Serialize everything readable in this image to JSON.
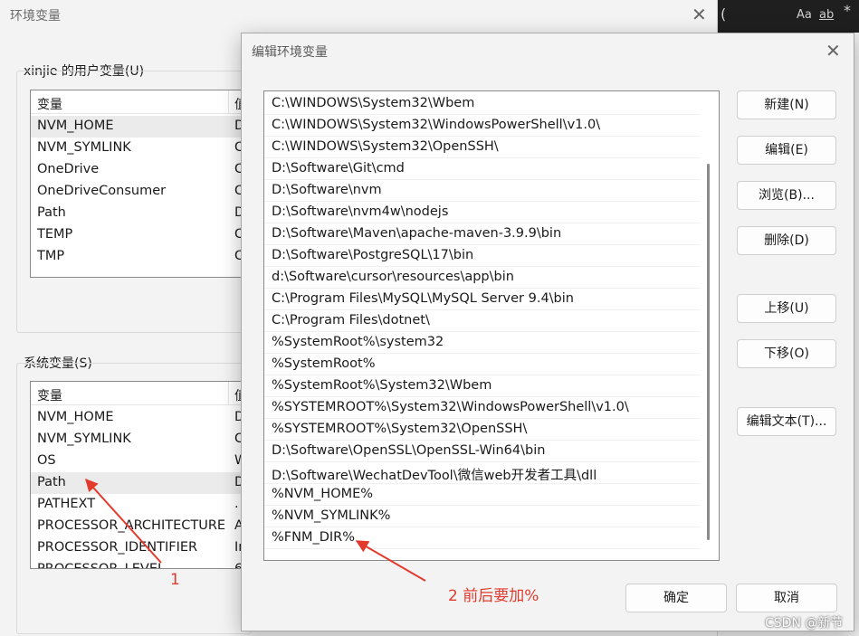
{
  "env_window": {
    "title": "环境变量",
    "close_glyph": "✕",
    "user_group_label": "xinjie 的用户变量(U)",
    "system_group_label": "系统变量(S)",
    "col_variable": "变量",
    "col_value": "值",
    "user_vars": [
      {
        "name": "NVM_HOME",
        "value": "D"
      },
      {
        "name": "NVM_SYMLINK",
        "value": "C"
      },
      {
        "name": "OneDrive",
        "value": "C"
      },
      {
        "name": "OneDriveConsumer",
        "value": "C"
      },
      {
        "name": "Path",
        "value": "D"
      },
      {
        "name": "TEMP",
        "value": "C"
      },
      {
        "name": "TMP",
        "value": "C"
      }
    ],
    "system_vars": [
      {
        "name": "NVM_HOME",
        "value": "D"
      },
      {
        "name": "NVM_SYMLINK",
        "value": "C"
      },
      {
        "name": "OS",
        "value": "W"
      },
      {
        "name": "Path",
        "value": "D"
      },
      {
        "name": "PATHEXT",
        "value": "."
      },
      {
        "name": "PROCESSOR_ARCHITECTURE",
        "value": "A"
      },
      {
        "name": "PROCESSOR_IDENTIFIER",
        "value": "In"
      },
      {
        "name": "PROCESSOR_LEVEL",
        "value": "6"
      }
    ]
  },
  "terminal": {
    "paren": "(",
    "match_case": "Aa",
    "whole_word": "ab",
    "regex": "*"
  },
  "edit_dialog": {
    "title": "编辑环境变量",
    "close_glyph": "✕",
    "paths": [
      "C:\\WINDOWS\\System32\\Wbem",
      "C:\\WINDOWS\\System32\\WindowsPowerShell\\v1.0\\",
      "C:\\WINDOWS\\System32\\OpenSSH\\",
      "D:\\Software\\Git\\cmd",
      "D:\\Software\\nvm",
      "D:\\Software\\nvm4w\\nodejs",
      "D:\\Software\\Maven\\apache-maven-3.9.9\\bin",
      "D:\\Software\\PostgreSQL\\17\\bin",
      "d:\\Software\\cursor\\resources\\app\\bin",
      "C:\\Program Files\\MySQL\\MySQL Server 9.4\\bin",
      "C:\\Program Files\\dotnet\\",
      "%SystemRoot%\\system32",
      "%SystemRoot%",
      "%SystemRoot%\\System32\\Wbem",
      "%SYSTEMROOT%\\System32\\WindowsPowerShell\\v1.0\\",
      "%SYSTEMROOT%\\System32\\OpenSSH\\",
      "D:\\Software\\OpenSSL\\OpenSSL-Win64\\bin",
      "D:\\Software\\WechatDevTool\\微信web开发者工具\\dll",
      "%NVM_HOME%",
      "%NVM_SYMLINK%",
      "%FNM_DIR%"
    ],
    "buttons": {
      "new": "新建(N)",
      "edit": "编辑(E)",
      "browse": "浏览(B)...",
      "delete": "删除(D)",
      "move_up": "上移(U)",
      "move_down": "下移(O)",
      "edit_text": "编辑文本(T)...",
      "ok": "确定",
      "cancel": "取消"
    }
  },
  "annotations": {
    "label_1": "1",
    "label_2": "2 前后要加%",
    "color": "#e23b2e"
  },
  "watermark": "CSDN @新节"
}
